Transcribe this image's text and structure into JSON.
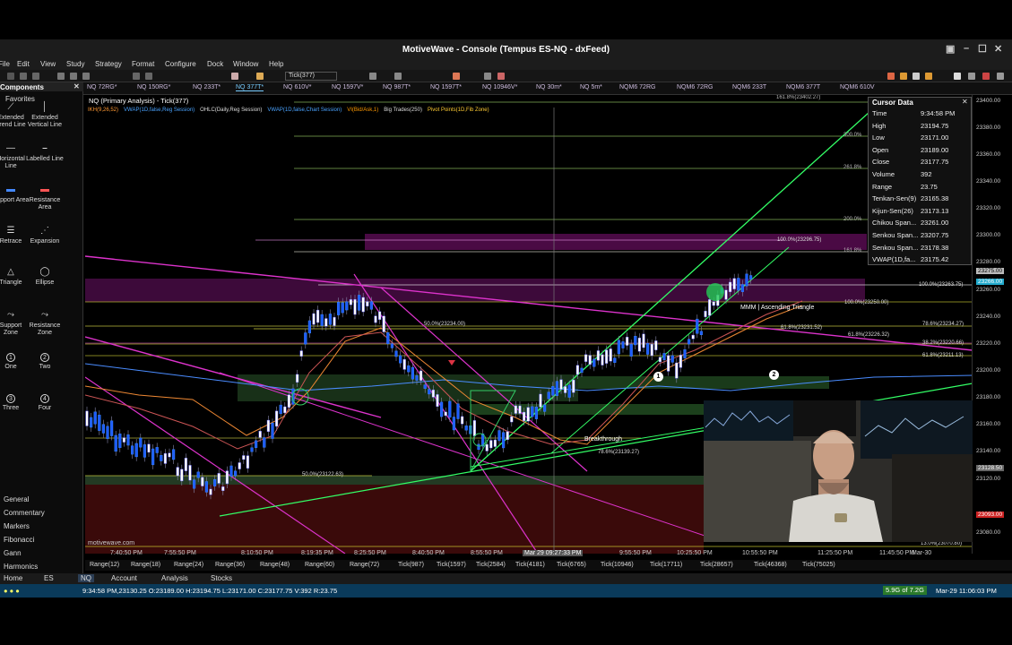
{
  "window": {
    "title": "MotiveWave - Console (Tempus ES-NQ - dxFeed)"
  },
  "menu": [
    "File",
    "Edit",
    "View",
    "Study",
    "Strategy",
    "Format",
    "Configure",
    "Dock",
    "Window",
    "Help"
  ],
  "toolbar": {
    "bar_size": "Tick(377)"
  },
  "symbol_tabs": [
    "NQ 72RG*",
    "NQ 150RG*",
    "NQ 233T*",
    "NQ 377T*",
    "NQ 610V*",
    "NQ 1597V*",
    "NQ 987T*",
    "NQ 1597T*",
    "NQ 10946V*",
    "NQ 30m*",
    "NQ 5m*",
    "NQM6 72RG",
    "NQM6 72RG",
    "NQM6 233T",
    "NQM6 377T",
    "NQM6 610V"
  ],
  "components": {
    "title": "Components",
    "favorites_label": "Favorites",
    "tools": [
      {
        "label": "Extended Trend Line",
        "icon": "trend-line-icon"
      },
      {
        "label": "Extended Vertical Line",
        "icon": "vertical-line-icon"
      },
      {
        "label": "Horizontal Line",
        "icon": "horizontal-line-icon"
      },
      {
        "label": "Labelled Line",
        "icon": "labelled-line-icon"
      },
      {
        "label": "Support Area",
        "icon": "support-area-icon"
      },
      {
        "label": "Resistance Area",
        "icon": "resistance-area-icon"
      },
      {
        "label": "Retrace",
        "icon": "retrace-icon"
      },
      {
        "label": "Expansion",
        "icon": "expansion-icon"
      },
      {
        "label": "Triangle",
        "icon": "triangle-icon"
      },
      {
        "label": "Ellipse",
        "icon": "ellipse-icon"
      },
      {
        "label": "Support Zone",
        "icon": "support-zone-icon"
      },
      {
        "label": "Resistance Zone",
        "icon": "resistance-zone-icon"
      },
      {
        "label": "One",
        "icon": "one-icon",
        "glyph": "1"
      },
      {
        "label": "Two",
        "icon": "two-icon",
        "glyph": "2"
      },
      {
        "label": "Three",
        "icon": "three-icon",
        "glyph": "3"
      },
      {
        "label": "Four",
        "icon": "four-icon",
        "glyph": "4"
      }
    ],
    "categories": [
      "General",
      "Commentary",
      "Markers",
      "Fibonacci",
      "Gann",
      "Harmonics"
    ]
  },
  "chart": {
    "title": "NQ (Primary Analysis) - Tick(377)",
    "studies": [
      {
        "text": "IKH(9,26,52)",
        "color": "#ff9933"
      },
      {
        "text": "VWAP(1D,false,Reg Session)",
        "color": "#4aa3ff"
      },
      {
        "text": "OHLC(Daily,Reg Session)",
        "color": "#dddddd"
      },
      {
        "text": "VWAP(1D,false,Chart Session)",
        "color": "#4aa3ff"
      },
      {
        "text": "VI(Bid/Ask,1)",
        "color": "#ff9900"
      },
      {
        "text": "Big Trades(250)",
        "color": "#dddddd"
      },
      {
        "text": "Pivot Points(1D,Fib Zone)",
        "color": "#ffcc33"
      }
    ],
    "watermark": "motivewave.com",
    "annotations": {
      "fib_1618_top": "161.8%(23402.27)",
      "fib_300": "300.0%",
      "fib_2618": "261.8%",
      "fib_200": "200.0%",
      "fib_1618": "161.8%",
      "fib_100_upper": "100.0%(23296.75)",
      "fib_100_a": "100.0%(23263.75)",
      "fib_100_b": "100.0%(23250.00)",
      "fib_50_upper": "50.0%(23234.00)",
      "fib_786_a": "78.6%(23234.27)",
      "fib_618_a": "61.8%(23231.52)",
      "fib_618_b": "61.8%(23226.32)",
      "fib_382": "38.2%(23220.66)",
      "fib_618_c": "61.8%(23211.13)",
      "fib_786_b": "78.6%(23139.27)",
      "fib_50_lower": "50.0%(23122.63)",
      "fib_13": "13.0%(23070.80)",
      "pattern": "MMM | Ascending Triangle",
      "breakthrough": "Breakthrough",
      "marker_one": "1",
      "marker_two": "2"
    }
  },
  "cursor_data": {
    "title": "Cursor Data",
    "rows": [
      {
        "label": "Time",
        "value": "9:34:58 PM"
      },
      {
        "label": "High",
        "value": "23194.75"
      },
      {
        "label": "Low",
        "value": "23171.00"
      },
      {
        "label": "Open",
        "value": "23189.00"
      },
      {
        "label": "Close",
        "value": "23177.75"
      },
      {
        "label": "Volume",
        "value": "392"
      },
      {
        "label": "Range",
        "value": "23.75"
      },
      {
        "label": "Tenkan-Sen(9)",
        "value": "23165.38"
      },
      {
        "label": "Kijun-Sen(26)",
        "value": "23173.13"
      },
      {
        "label": "Chikou Span...",
        "value": "23261.00"
      },
      {
        "label": "Senkou Span...",
        "value": "23207.75"
      },
      {
        "label": "Senkou Span...",
        "value": "23178.38"
      },
      {
        "label": "VWAP(1D,fa...",
        "value": "23175.42"
      }
    ]
  },
  "y_axis": [
    "23400.00",
    "23380.00",
    "23360.00",
    "23340.00",
    "23320.00",
    "23300.00",
    "23280.00",
    "23275.00",
    "23266.00",
    "23260.00",
    "23240.00",
    "23220.00",
    "23200.00",
    "23180.00",
    "23160.00",
    "23140.00",
    "23128.50",
    "23120.00",
    "23093.00",
    "23080.00"
  ],
  "x_axis": [
    "7:40:50 PM",
    "7:55:50 PM",
    "8:10:50 PM",
    "8:19:35 PM",
    "8:25:50 PM",
    "8:40:50 PM",
    "8:55:50 PM",
    "Mar 29 09:27:33 PM",
    "9:55:50 PM",
    "10:25:50 PM",
    "10:55:50 PM",
    "11:25:50 PM",
    "11:45:50 PM",
    "Mar-30"
  ],
  "range_bar": [
    "Range(12)",
    "Range(18)",
    "Range(24)",
    "Range(36)",
    "Range(48)",
    "Range(60)",
    "Range(72)",
    "Tick(987)",
    "Tick(1597)",
    "Tick(2584)",
    "Tick(4181)",
    "Tick(6765)",
    "Tick(10946)",
    "Tick(17711)",
    "Tick(28657)",
    "Tick(46368)",
    "Tick(75025)"
  ],
  "bottom_tabs": [
    "Home",
    "NQ",
    "ES",
    "Account",
    "Analysis",
    "Stocks"
  ],
  "status": {
    "bar_info": "9:34:58 PM,23130.25 O:23189.00 H:23194.75 L:23171.00 C:23177.75 V:392 R:23.75",
    "memory": "5.9G of 7.2G",
    "datetime": "Mar-29 11:06:03 PM"
  }
}
